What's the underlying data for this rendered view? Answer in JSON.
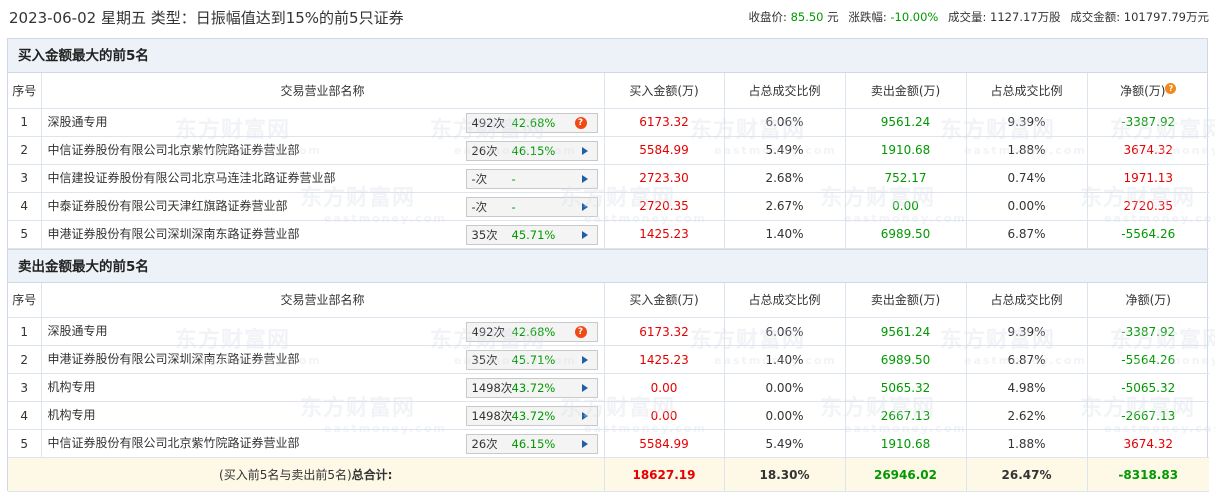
{
  "header": {
    "title": "2023-06-02 星期五 类型：日振幅值达到15%的前5只证券",
    "close_label": "收盘价:",
    "close_value": "85.50",
    "close_unit": "元",
    "change_label": "涨跌幅:",
    "change_value": "-10.00%",
    "volume_label": "成交量:",
    "volume_value": "1127.17万股",
    "turnover_label": "成交金额:",
    "turnover_value": "101797.79万元"
  },
  "watermark": {
    "cn": "东方财富网",
    "en": "eastmoney.com"
  },
  "columns": [
    "序号",
    "交易营业部名称",
    "买入金额(万)",
    "占总成交比例",
    "卖出金额(万)",
    "占总成交比例",
    "净额(万)"
  ],
  "buy_section": {
    "title": "买入金额最大的前5名",
    "rows": [
      {
        "idx": "1",
        "name": "深股通专用",
        "count": "492次",
        "pct": "42.68%",
        "icon": "question-icon",
        "buy": "6173.32",
        "buy_ratio": "6.06%",
        "sell": "9561.24",
        "sell_ratio": "9.39%",
        "net": "-3387.92"
      },
      {
        "idx": "2",
        "name": "中信证券股份有限公司北京紫竹院路证券营业部",
        "count": "26次",
        "pct": "46.15%",
        "icon": "arrow-right-icon",
        "buy": "5584.99",
        "buy_ratio": "5.49%",
        "sell": "1910.68",
        "sell_ratio": "1.88%",
        "net": "3674.32"
      },
      {
        "idx": "3",
        "name": "中信建投证券股份有限公司北京马连洼北路证券营业部",
        "count": "-次",
        "pct": "-",
        "icon": "arrow-right-icon",
        "buy": "2723.30",
        "buy_ratio": "2.68%",
        "sell": "752.17",
        "sell_ratio": "0.74%",
        "net": "1971.13"
      },
      {
        "idx": "4",
        "name": "中泰证券股份有限公司天津红旗路证券营业部",
        "count": "-次",
        "pct": "-",
        "icon": "arrow-right-icon",
        "buy": "2720.35",
        "buy_ratio": "2.67%",
        "sell": "0.00",
        "sell_ratio": "0.00%",
        "net": "2720.35"
      },
      {
        "idx": "5",
        "name": "申港证券股份有限公司深圳深南东路证券营业部",
        "count": "35次",
        "pct": "45.71%",
        "icon": "arrow-right-icon",
        "buy": "1425.23",
        "buy_ratio": "1.40%",
        "sell": "6989.50",
        "sell_ratio": "6.87%",
        "net": "-5564.26"
      }
    ]
  },
  "sell_section": {
    "title": "卖出金额最大的前5名",
    "rows": [
      {
        "idx": "1",
        "name": "深股通专用",
        "count": "492次",
        "pct": "42.68%",
        "icon": "question-icon",
        "buy": "6173.32",
        "buy_ratio": "6.06%",
        "sell": "9561.24",
        "sell_ratio": "9.39%",
        "net": "-3387.92"
      },
      {
        "idx": "2",
        "name": "申港证券股份有限公司深圳深南东路证券营业部",
        "count": "35次",
        "pct": "45.71%",
        "icon": "arrow-right-icon",
        "buy": "1425.23",
        "buy_ratio": "1.40%",
        "sell": "6989.50",
        "sell_ratio": "6.87%",
        "net": "-5564.26"
      },
      {
        "idx": "3",
        "name": "机构专用",
        "count": "1498次",
        "pct": "43.72%",
        "icon": "arrow-right-icon",
        "buy": "0.00",
        "buy_ratio": "0.00%",
        "sell": "5065.32",
        "sell_ratio": "4.98%",
        "net": "-5065.32"
      },
      {
        "idx": "4",
        "name": "机构专用",
        "count": "1498次",
        "pct": "43.72%",
        "icon": "arrow-right-icon",
        "buy": "0.00",
        "buy_ratio": "0.00%",
        "sell": "2667.13",
        "sell_ratio": "2.62%",
        "net": "-2667.13"
      },
      {
        "idx": "5",
        "name": "中信证券股份有限公司北京紫竹院路证券营业部",
        "count": "26次",
        "pct": "46.15%",
        "icon": "arrow-right-icon",
        "buy": "5584.99",
        "buy_ratio": "5.49%",
        "sell": "1910.68",
        "sell_ratio": "1.88%",
        "net": "3674.32"
      }
    ]
  },
  "total": {
    "label_prefix": "(买入前5名与卖出前5名)",
    "label_bold": "总合计:",
    "buy": "18627.19",
    "buy_ratio": "18.30%",
    "sell": "26946.02",
    "sell_ratio": "26.47%",
    "net": "-8318.83"
  },
  "colors": {
    "header_bg": "#edf2f9",
    "border": "#cdd9e7",
    "positive": "#e60000",
    "negative": "#009900",
    "total_bg": "#fdf9e6"
  }
}
